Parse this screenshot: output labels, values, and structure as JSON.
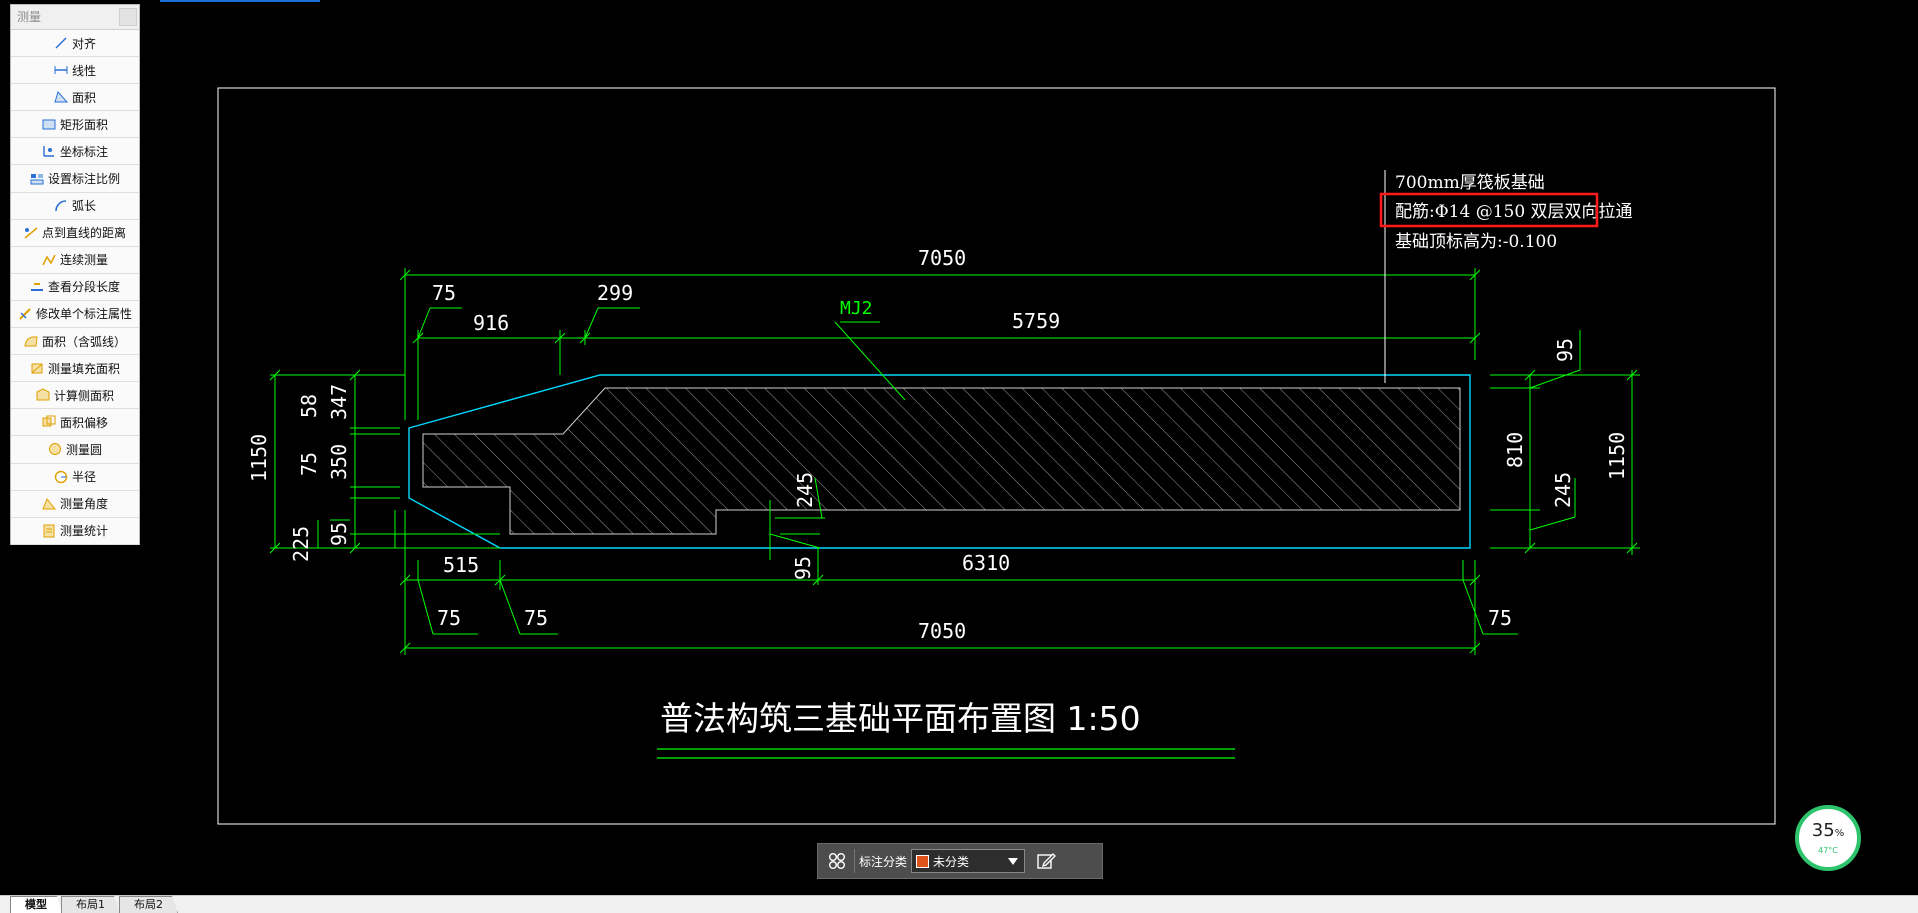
{
  "panel": {
    "title": "测量",
    "items": [
      {
        "label": "对齐",
        "icon": "align-measure-icon"
      },
      {
        "label": "线性",
        "icon": "linear-measure-icon"
      },
      {
        "label": "面积",
        "icon": "area-icon"
      },
      {
        "label": "矩形面积",
        "icon": "rectangle-area-icon"
      },
      {
        "label": "坐标标注",
        "icon": "coordinate-annotation-icon"
      },
      {
        "label": "设置标注比例",
        "icon": "annotation-scale-icon"
      },
      {
        "label": "弧长",
        "icon": "arc-length-icon"
      },
      {
        "label": "点到直线的距离",
        "icon": "point-line-distance-icon"
      },
      {
        "label": "连续测量",
        "icon": "continuous-measure-icon"
      },
      {
        "label": "查看分段长度",
        "icon": "segment-length-icon"
      },
      {
        "label": "修改单个标注属性",
        "icon": "edit-annotation-icon"
      },
      {
        "label": "面积（含弧线）",
        "icon": "arc-area-icon"
      },
      {
        "label": "测量填充面积",
        "icon": "fill-area-icon"
      },
      {
        "label": "计算侧面积",
        "icon": "side-area-icon"
      },
      {
        "label": "面积偏移",
        "icon": "area-offset-icon"
      },
      {
        "label": "测量圆",
        "icon": "circle-measure-icon"
      },
      {
        "label": "半径",
        "icon": "radius-icon"
      },
      {
        "label": "测量角度",
        "icon": "angle-measure-icon"
      },
      {
        "label": "测量统计",
        "icon": "measure-stats-icon"
      }
    ]
  },
  "drawing": {
    "notes": [
      "700mm厚筏板基础",
      "配筋:Φ14 @150 双层双向拉通",
      "基础顶标高为:-0.100"
    ],
    "title": "普法构筑三基础平面布置图 1:50",
    "mark_label": "MJ2",
    "dims": {
      "top_total": "7050",
      "top_75": "75",
      "top_299": "299",
      "top_916": "916",
      "top_5759": "5759",
      "bottom_515": "515",
      "bottom_95": "95",
      "bottom_6310": "6310",
      "bottom_75a": "75",
      "bottom_75b": "75",
      "bottom_total": "7050",
      "bottom_75c": "75",
      "inner_245": "245",
      "left_1150": "1150",
      "left_58": "58",
      "left_347": "347",
      "left_75": "75",
      "left_350": "350",
      "left_225": "225",
      "left_95": "95",
      "right_95": "95",
      "right_810": "810",
      "right_245": "245",
      "right_1150": "1150"
    },
    "colors": {
      "dim": "#00ff00",
      "outline": "#00d8ff",
      "text": "#ffffff",
      "highlight": "#ff1a1a",
      "frame": "#ffffff"
    }
  },
  "classbar": {
    "label": "标注分类",
    "value": "未分类",
    "swatch_color": "#e0531b"
  },
  "gauge": {
    "percent": "35",
    "unit": "%",
    "temp": "47°C"
  },
  "tabs": [
    "模型",
    "布局1",
    "布局2"
  ]
}
